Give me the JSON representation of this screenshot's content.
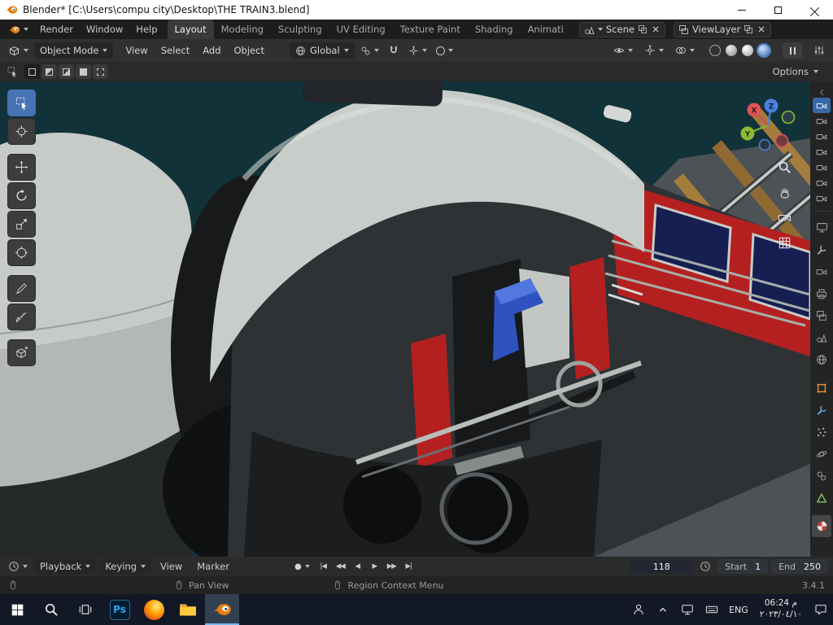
{
  "colors": {
    "accent_blue": "#4772b3",
    "viewport_teal": "#123239",
    "train_red": "#b42020",
    "train_roof_gray": "#c9cdca",
    "axis_x_red": "#e05355",
    "axis_y_green": "#8db832",
    "axis_z_blue": "#4a7fe0"
  },
  "title_bar": {
    "title": "Blender* [C:\\Users\\compu city\\Desktop\\THE TRAIN3.blend]"
  },
  "menu_bar": {
    "menus": [
      "Render",
      "Window",
      "Help"
    ],
    "workspaces": [
      "Layout",
      "Modeling",
      "Sculpting",
      "UV Editing",
      "Texture Paint",
      "Shading",
      "Animati"
    ],
    "scene_selector": {
      "label": "Scene"
    },
    "viewlayer_selector": {
      "label": "ViewLayer"
    }
  },
  "tool_header": {
    "mode": "Object Mode",
    "menus": [
      "View",
      "Select",
      "Add",
      "Object"
    ],
    "orientation": "Global"
  },
  "tool_settings": {
    "options_label": "Options"
  },
  "viewport": {
    "gizmo": {
      "x": "X",
      "y": "Y",
      "z": "Z"
    }
  },
  "timeline": {
    "playback": "Playback",
    "keying": "Keying",
    "view_menu": "View",
    "marker_menu": "Marker",
    "icons": {
      "record": "●",
      "jump_start": "|◀",
      "prev_keyframe": "◀◀",
      "play_reverse": "◀",
      "play": "▶",
      "next_keyframe": "▶▶",
      "jump_end": "▶|"
    },
    "current_frame": "118",
    "start_label": "Start",
    "start_value": "1",
    "end_label": "End",
    "end_value": "250"
  },
  "status_bar": {
    "pan_view": "Pan View",
    "region_context_menu": "Region Context Menu",
    "version": "3.4.1"
  },
  "taskbar": {
    "photoshop_label": "Ps",
    "language": "ENG",
    "time": "06:24 م",
    "date": "٢٠٢٣/٠٤/١٠"
  }
}
